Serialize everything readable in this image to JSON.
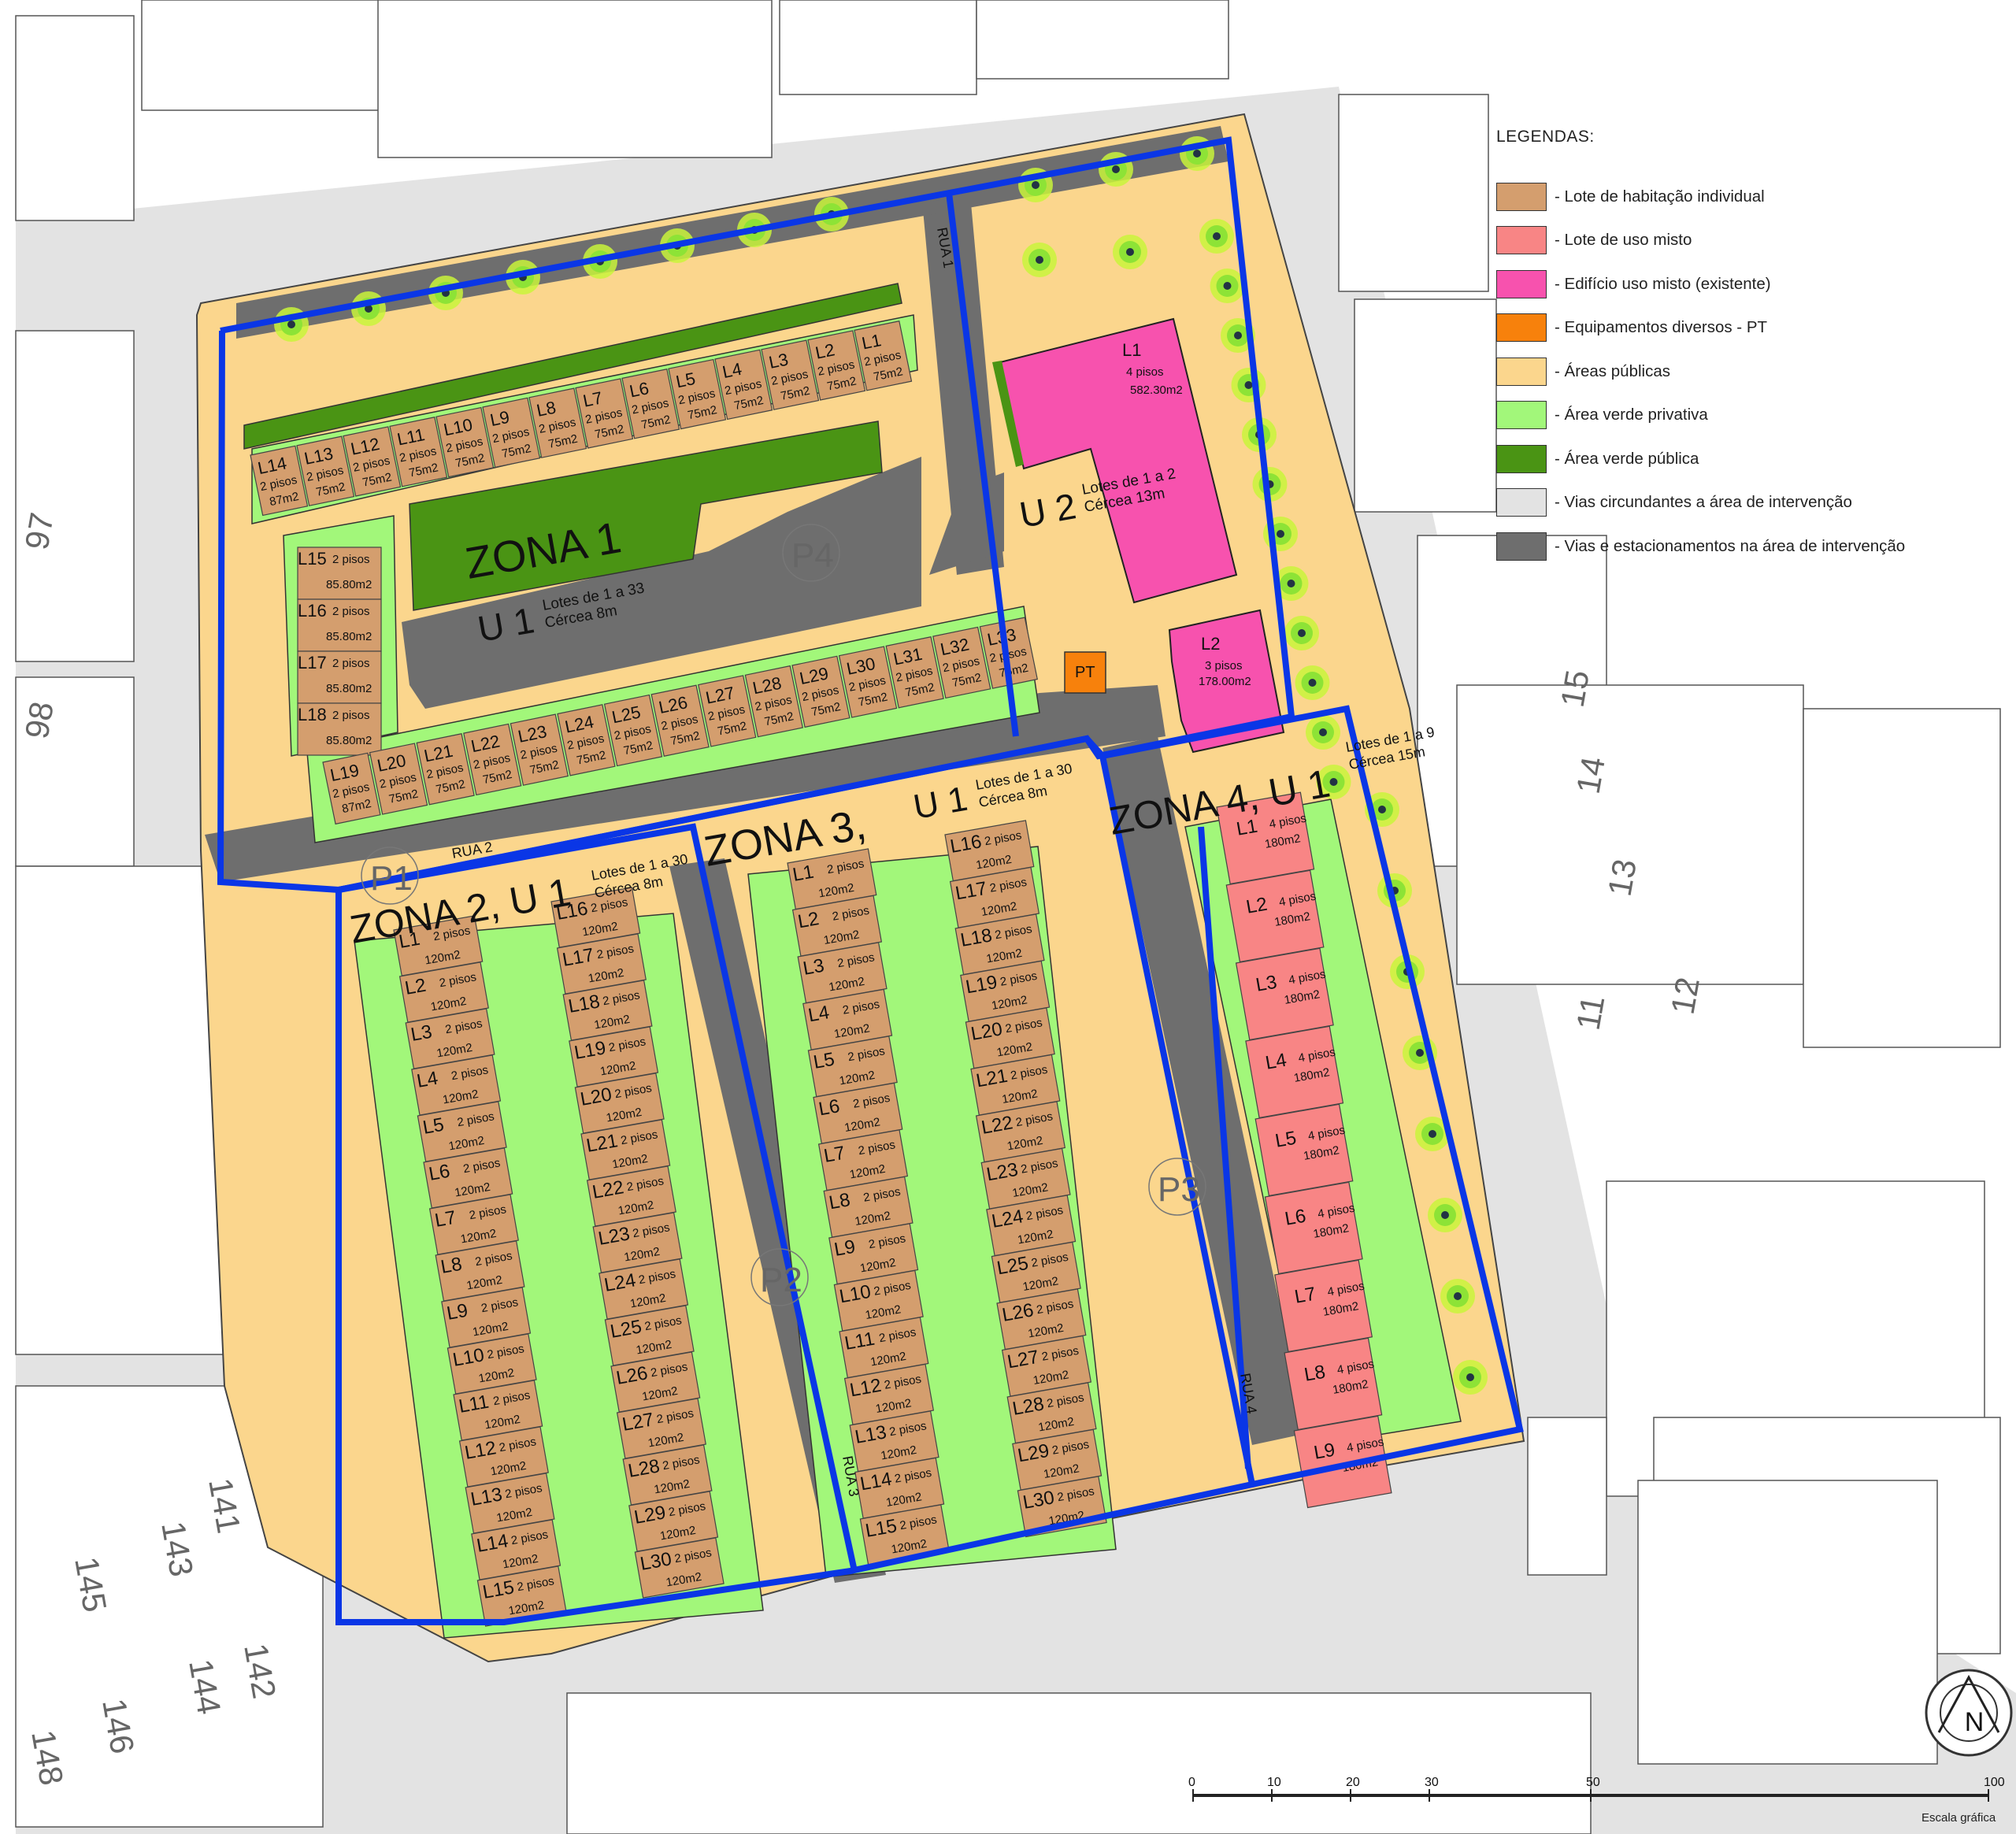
{
  "legend": {
    "title": "LEGENDAS:",
    "items": [
      {
        "label": "- Lote de habitação individual",
        "color": "#d49e6e"
      },
      {
        "label": "- Lote de uso misto",
        "color": "#f88585"
      },
      {
        "label": "- Edifício uso misto (existente)",
        "color": "#f752ae"
      },
      {
        "label": "- Equipamentos diversos - PT",
        "color": "#f7810c"
      },
      {
        "label": "- Áreas públicas",
        "color": "#fbd68d"
      },
      {
        "label": "- Área verde privativa",
        "color": "#a2f77a"
      },
      {
        "label": "- Área verde pública",
        "color": "#4a9414"
      },
      {
        "label": "- Vias circundantes a área de intervenção",
        "color": "#e3e3e3"
      },
      {
        "label": "- Vias e estacionamentos na área de intervenção",
        "color": "#6e6e6e"
      }
    ]
  },
  "zones": {
    "zona1": {
      "title": "ZONA 1",
      "unit": "U 1",
      "lots": "Lotes de 1 a 33",
      "cercea": "Cércea 8m"
    },
    "zona2": {
      "title": "ZONA 2, U 1",
      "lots": "Lotes de 1 a 30",
      "cercea": "Cércea 8m"
    },
    "zona3": {
      "title": "ZONA 3,",
      "unit": "U 1",
      "lots": "Lotes de 1 a 30",
      "cercea": "Cércea 8m"
    },
    "zona4": {
      "title": "ZONA 4, U 1",
      "lots": "Lotes de 1 a 9",
      "cercea": "Cércea 15m"
    },
    "u2": {
      "title": "U 2",
      "lots": "Lotes de 1 a 2",
      "cercea": "Cércea 13m"
    }
  },
  "streets": [
    "RUA 1",
    "RUA 2",
    "RUA 3",
    "RUA 4"
  ],
  "parkings": [
    "P1",
    "P2",
    "P3",
    "P4"
  ],
  "pt_label": "PT",
  "zona1_top_lots": [
    {
      "id": "L14",
      "floors": "2 pisos",
      "area": "87m2"
    },
    {
      "id": "L13",
      "floors": "2 pisos",
      "area": "75m2"
    },
    {
      "id": "L12",
      "floors": "2 pisos",
      "area": "75m2"
    },
    {
      "id": "L11",
      "floors": "2 pisos",
      "area": "75m2"
    },
    {
      "id": "L10",
      "floors": "2 pisos",
      "area": "75m2"
    },
    {
      "id": "L9",
      "floors": "2 pisos",
      "area": "75m2"
    },
    {
      "id": "L8",
      "floors": "2 pisos",
      "area": "75m2"
    },
    {
      "id": "L7",
      "floors": "2 pisos",
      "area": "75m2"
    },
    {
      "id": "L6",
      "floors": "2 pisos",
      "area": "75m2"
    },
    {
      "id": "L5",
      "floors": "2 pisos",
      "area": "75m2"
    },
    {
      "id": "L4",
      "floors": "2 pisos",
      "area": "75m2"
    },
    {
      "id": "L3",
      "floors": "2 pisos",
      "area": "75m2"
    },
    {
      "id": "L2",
      "floors": "2 pisos",
      "area": "75m2"
    },
    {
      "id": "L1",
      "floors": "2 pisos",
      "area": "75m2"
    }
  ],
  "zona1_side_lots": [
    {
      "id": "L15",
      "floors": "2 pisos",
      "area": "85.80m2"
    },
    {
      "id": "L16",
      "floors": "2 pisos",
      "area": "85.80m2"
    },
    {
      "id": "L17",
      "floors": "2 pisos",
      "area": "85.80m2"
    },
    {
      "id": "L18",
      "floors": "2 pisos",
      "area": "85.80m2"
    }
  ],
  "zona1_bottom_lots": [
    {
      "id": "L19",
      "floors": "2 pisos",
      "area": "87m2"
    },
    {
      "id": "L20",
      "floors": "2 pisos",
      "area": "75m2"
    },
    {
      "id": "L21",
      "floors": "2 pisos",
      "area": "75m2"
    },
    {
      "id": "L22",
      "floors": "2 pisos",
      "area": "75m2"
    },
    {
      "id": "L23",
      "floors": "2 pisos",
      "area": "75m2"
    },
    {
      "id": "L24",
      "floors": "2 pisos",
      "area": "75m2"
    },
    {
      "id": "L25",
      "floors": "2 pisos",
      "area": "75m2"
    },
    {
      "id": "L26",
      "floors": "2 pisos",
      "area": "75m2"
    },
    {
      "id": "L27",
      "floors": "2 pisos",
      "area": "75m2"
    },
    {
      "id": "L28",
      "floors": "2 pisos",
      "area": "75m2"
    },
    {
      "id": "L29",
      "floors": "2 pisos",
      "area": "75m2"
    },
    {
      "id": "L30",
      "floors": "2 pisos",
      "area": "75m2"
    },
    {
      "id": "L31",
      "floors": "2 pisos",
      "area": "75m2"
    },
    {
      "id": "L32",
      "floors": "2 pisos",
      "area": "75m2"
    },
    {
      "id": "L33",
      "floors": "2 pisos",
      "area": "75m2"
    }
  ],
  "zona2_lots": {
    "floors": "2 pisos",
    "area": "120m2",
    "left": [
      "L1",
      "L2",
      "L3",
      "L4",
      "L5",
      "L6",
      "L7",
      "L8",
      "L9",
      "L10",
      "L11",
      "L12",
      "L13",
      "L14",
      "L15"
    ],
    "right": [
      "L16",
      "L17",
      "L18",
      "L19",
      "L20",
      "L21",
      "L22",
      "L23",
      "L24",
      "L25",
      "L26",
      "L27",
      "L28",
      "L29",
      "L30"
    ]
  },
  "zona3_lots": {
    "floors": "2 pisos",
    "area": "120m2",
    "left": [
      "L1",
      "L2",
      "L3",
      "L4",
      "L5",
      "L6",
      "L7",
      "L8",
      "L9",
      "L10",
      "L11",
      "L12",
      "L13",
      "L14",
      "L15"
    ],
    "right": [
      "L16",
      "L17",
      "L18",
      "L19",
      "L20",
      "L21",
      "L22",
      "L23",
      "L24",
      "L25",
      "L26",
      "L27",
      "L28",
      "L29",
      "L30"
    ]
  },
  "zona4_lots": {
    "floors": "4 pisos",
    "area": "180m2",
    "ids": [
      "L1",
      "L2",
      "L3",
      "L4",
      "L5",
      "L6",
      "L7",
      "L8",
      "L9"
    ]
  },
  "u2_lots": [
    {
      "id": "L1",
      "floors": "4 pisos",
      "area": "582.30m2"
    },
    {
      "id": "L2",
      "floors": "3 pisos",
      "area": "178.00m2"
    }
  ],
  "surrounding_building_numbers": [
    "97",
    "98",
    "15",
    "14",
    "13",
    "12",
    "11",
    "141",
    "143",
    "145",
    "142",
    "144",
    "146",
    "148"
  ],
  "north_arrow": "N",
  "scale": {
    "ticks": [
      "0",
      "10",
      "20",
      "30",
      "50",
      "100"
    ],
    "caption": "Escala gráfica"
  }
}
